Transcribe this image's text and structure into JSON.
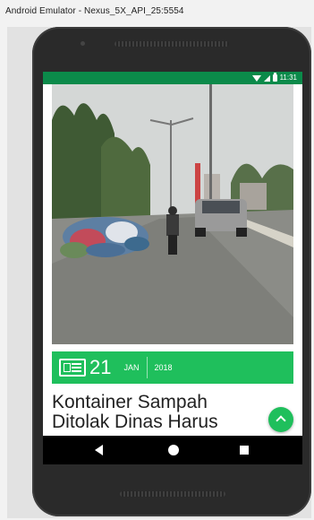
{
  "window": {
    "title": "Android Emulator - Nexus_5X_API_25:5554"
  },
  "status_bar": {
    "time": "11:31",
    "icons": [
      "wifi-icon",
      "signal-icon",
      "battery-icon"
    ],
    "color": "#0b8a4a"
  },
  "article": {
    "image": "street-garbage-photo",
    "date": {
      "day": "21",
      "month": "JAN",
      "year": "2018",
      "icon": "newspaper-icon"
    },
    "headline": "Kontainer Sampah Ditolak Dinas Harus",
    "accent_color": "#1fbf5c"
  },
  "fab": {
    "icon": "chevron-up-icon"
  },
  "nav_bar": {
    "items": [
      "back-icon",
      "home-icon",
      "recent-apps-icon"
    ]
  }
}
